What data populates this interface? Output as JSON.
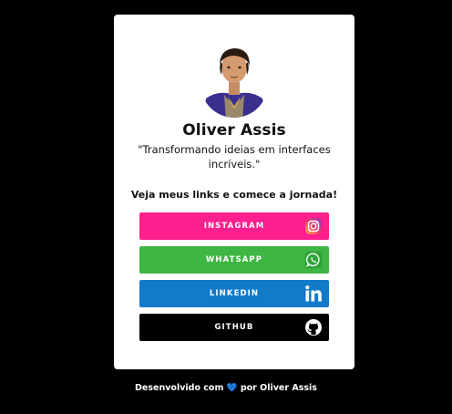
{
  "profile": {
    "name": "Oliver Assis",
    "bio": "\"Transformando ideias em interfaces incríveis.\"",
    "cta": "Veja meus links e comece a jornada!",
    "avatar_icon": "avatar-photo"
  },
  "links": [
    {
      "label": "INSTAGRAM",
      "icon": "instagram-icon",
      "color": "#ff1f8e"
    },
    {
      "label": "WHATSAPP",
      "icon": "whatsapp-icon",
      "color": "#3fb643"
    },
    {
      "label": "LINKEDIN",
      "icon": "linkedin-icon",
      "color": "#117ac9"
    },
    {
      "label": "GITHUB",
      "icon": "github-icon",
      "color": "#000000"
    }
  ],
  "footer": {
    "prefix": "Desenvolvido com",
    "heart": "💙",
    "suffix": "por Oliver Assis"
  },
  "colors": {
    "background": "#000000",
    "card": "#ffffff",
    "text": "#111111"
  }
}
